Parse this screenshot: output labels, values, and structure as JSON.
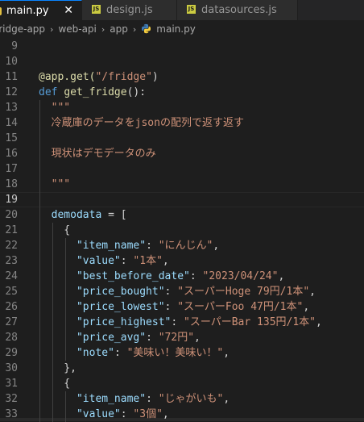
{
  "tabs": [
    {
      "label": "main.py",
      "active": true,
      "icon": "python-icon",
      "close": "✕"
    },
    {
      "label": "design.js",
      "active": false,
      "icon": "js-icon"
    },
    {
      "label": "datasources.js",
      "active": false,
      "icon": "js-icon"
    }
  ],
  "icons": {
    "js_text": "JS"
  },
  "breadcrumb": {
    "items": [
      "fridge-app",
      "web-api",
      "app",
      "main.py"
    ],
    "separator": "›"
  },
  "colors": {
    "keyword": "#569cd6",
    "function": "#dcdcaa",
    "string": "#ce9178",
    "variable": "#9cdcfe",
    "default": "#d4d4d4",
    "line_number": "#858585",
    "tab_accent": "#0a84ff"
  },
  "editor": {
    "current_line": 19,
    "lines": [
      {
        "n": "9",
        "tokens": []
      },
      {
        "n": "10",
        "tokens": []
      },
      {
        "n": "11",
        "tokens": [
          {
            "t": "@app.get(",
            "c": "dec"
          },
          {
            "t": "\"/fridge\"",
            "c": "str"
          },
          {
            "t": ")",
            "c": "def"
          }
        ]
      },
      {
        "n": "12",
        "tokens": [
          {
            "t": "def",
            "c": "kw"
          },
          {
            "t": " ",
            "c": "def"
          },
          {
            "t": "get_fridge",
            "c": "fn"
          },
          {
            "t": "():",
            "c": "def"
          }
        ]
      },
      {
        "n": "13",
        "tokens": [
          {
            "t": "  \"\"\"",
            "c": "str"
          }
        ]
      },
      {
        "n": "14",
        "tokens": [
          {
            "t": "  冷蔵庫のデータをjsonの配列で返す返す",
            "c": "str"
          }
        ]
      },
      {
        "n": "15",
        "tokens": []
      },
      {
        "n": "16",
        "tokens": [
          {
            "t": "  現状はデモデータのみ",
            "c": "str"
          }
        ]
      },
      {
        "n": "17",
        "tokens": []
      },
      {
        "n": "18",
        "tokens": [
          {
            "t": "  \"\"\"",
            "c": "str"
          }
        ]
      },
      {
        "n": "19",
        "tokens": []
      },
      {
        "n": "20",
        "tokens": [
          {
            "t": "  ",
            "c": "def"
          },
          {
            "t": "demodata",
            "c": "var"
          },
          {
            "t": " = [",
            "c": "def"
          }
        ]
      },
      {
        "n": "21",
        "tokens": [
          {
            "t": "    {",
            "c": "def"
          }
        ]
      },
      {
        "n": "22",
        "tokens": [
          {
            "t": "      ",
            "c": "def"
          },
          {
            "t": "\"item_name\"",
            "c": "var"
          },
          {
            "t": ": ",
            "c": "def"
          },
          {
            "t": "\"にんじん\"",
            "c": "str"
          },
          {
            "t": ",",
            "c": "def"
          }
        ]
      },
      {
        "n": "23",
        "tokens": [
          {
            "t": "      ",
            "c": "def"
          },
          {
            "t": "\"value\"",
            "c": "var"
          },
          {
            "t": ": ",
            "c": "def"
          },
          {
            "t": "\"1本\"",
            "c": "str"
          },
          {
            "t": ",",
            "c": "def"
          }
        ]
      },
      {
        "n": "24",
        "tokens": [
          {
            "t": "      ",
            "c": "def"
          },
          {
            "t": "\"best_before_date\"",
            "c": "var"
          },
          {
            "t": ": ",
            "c": "def"
          },
          {
            "t": "\"2023/04/24\"",
            "c": "str"
          },
          {
            "t": ",",
            "c": "def"
          }
        ]
      },
      {
        "n": "25",
        "tokens": [
          {
            "t": "      ",
            "c": "def"
          },
          {
            "t": "\"price_bought\"",
            "c": "var"
          },
          {
            "t": ": ",
            "c": "def"
          },
          {
            "t": "\"スーパーHoge 79円/1本\"",
            "c": "str"
          },
          {
            "t": ",",
            "c": "def"
          }
        ]
      },
      {
        "n": "26",
        "tokens": [
          {
            "t": "      ",
            "c": "def"
          },
          {
            "t": "\"price_lowest\"",
            "c": "var"
          },
          {
            "t": ": ",
            "c": "def"
          },
          {
            "t": "\"スーパーFoo 47円/1本\"",
            "c": "str"
          },
          {
            "t": ",",
            "c": "def"
          }
        ]
      },
      {
        "n": "27",
        "tokens": [
          {
            "t": "      ",
            "c": "def"
          },
          {
            "t": "\"price_highest\"",
            "c": "var"
          },
          {
            "t": ": ",
            "c": "def"
          },
          {
            "t": "\"スーパーBar 135円/1本\"",
            "c": "str"
          },
          {
            "t": ",",
            "c": "def"
          }
        ]
      },
      {
        "n": "28",
        "tokens": [
          {
            "t": "      ",
            "c": "def"
          },
          {
            "t": "\"price_avg\"",
            "c": "var"
          },
          {
            "t": ": ",
            "c": "def"
          },
          {
            "t": "\"72円\"",
            "c": "str"
          },
          {
            "t": ",",
            "c": "def"
          }
        ]
      },
      {
        "n": "29",
        "tokens": [
          {
            "t": "      ",
            "c": "def"
          },
          {
            "t": "\"note\"",
            "c": "var"
          },
          {
            "t": ": ",
            "c": "def"
          },
          {
            "t": "\"美味い！美味い！\"",
            "c": "str"
          },
          {
            "t": ",",
            "c": "def"
          }
        ]
      },
      {
        "n": "30",
        "tokens": [
          {
            "t": "    },",
            "c": "def"
          }
        ]
      },
      {
        "n": "31",
        "tokens": [
          {
            "t": "    {",
            "c": "def"
          }
        ]
      },
      {
        "n": "32",
        "tokens": [
          {
            "t": "      ",
            "c": "def"
          },
          {
            "t": "\"item_name\"",
            "c": "var"
          },
          {
            "t": ": ",
            "c": "def"
          },
          {
            "t": "\"じゃがいも\"",
            "c": "str"
          },
          {
            "t": ",",
            "c": "def"
          }
        ]
      },
      {
        "n": "33",
        "tokens": [
          {
            "t": "      ",
            "c": "def"
          },
          {
            "t": "\"value\"",
            "c": "var"
          },
          {
            "t": ": ",
            "c": "def"
          },
          {
            "t": "\"3個\"",
            "c": "str"
          },
          {
            "t": ",",
            "c": "def"
          }
        ]
      }
    ]
  }
}
